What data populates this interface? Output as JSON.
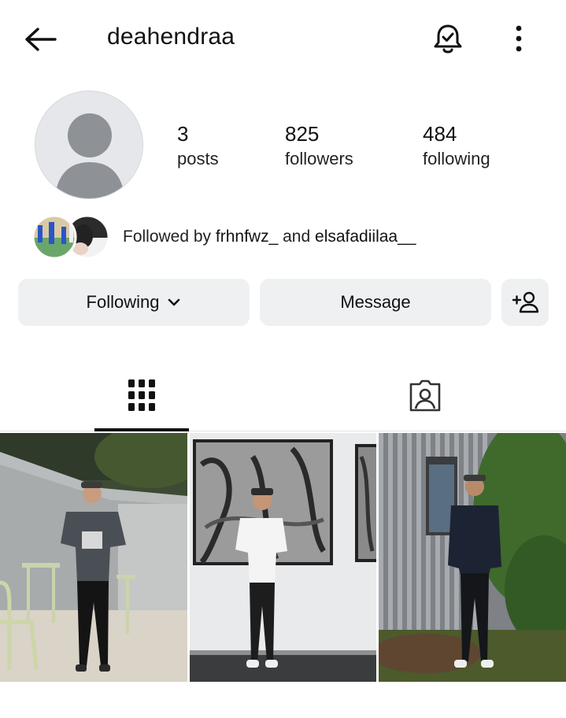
{
  "header": {
    "username": "deahendraa",
    "back_icon": "back-arrow-icon",
    "notification_icon": "bell-check-icon",
    "more_icon": "more-vertical-icon"
  },
  "profile": {
    "posts_count": "3",
    "posts_label": "posts",
    "followers_count": "825",
    "followers_label": "followers",
    "following_count": "484",
    "following_label": "following"
  },
  "followed_by": {
    "prefix": "Followed by",
    "user1": "frhnfwz_",
    "conjunction": "and",
    "user2": "elsafadiilaa__"
  },
  "actions": {
    "following_label": "Following",
    "message_label": "Message",
    "add_user_icon": "add-user-icon"
  },
  "tabs": [
    {
      "name": "grid",
      "icon": "grid-icon",
      "active": true
    },
    {
      "name": "tagged",
      "icon": "tagged-person-icon",
      "active": false
    }
  ],
  "colors": {
    "button_bg": "#eff0f2",
    "text": "#111111",
    "divider": "#e3e3e3"
  }
}
